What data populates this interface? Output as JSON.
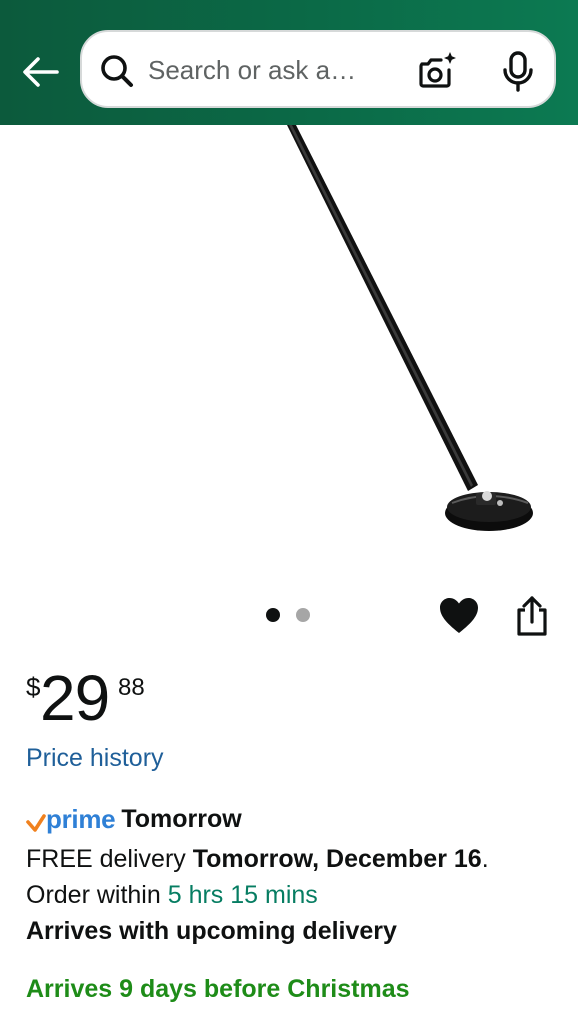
{
  "header": {
    "search_placeholder": "Search or ask a…",
    "back_icon": "arrow-left-icon",
    "search_icon": "magnifier-icon",
    "camera_icon": "camera-sparkle-icon",
    "mic_icon": "microphone-icon",
    "gradient_colors": [
      "#0c5a3c",
      "#0c7a52"
    ]
  },
  "product": {
    "image_description_icon": "kickstand-product-image",
    "carousel": {
      "count": 2,
      "active_index": 0
    },
    "favorite_icon": "heart-filled-icon",
    "share_icon": "share-icon"
  },
  "price": {
    "symbol": "$",
    "whole": "29",
    "fraction": "88"
  },
  "price_history_label": "Price history",
  "delivery": {
    "prime_label": "prime",
    "prime_speed": "Tomorrow",
    "free_delivery_prefix": "FREE delivery ",
    "delivery_date": "Tomorrow, December 16",
    "delivery_suffix": ".",
    "order_within_prefix": "Order within ",
    "order_within_time": "5 hrs 15 mins",
    "arrives_upcoming": "Arrives with upcoming delivery",
    "christmas_note": "Arrives 9 days before Christmas"
  },
  "colors": {
    "link_blue": "#1f5f99",
    "prime_blue": "#2f80d6",
    "prime_orange": "#f0811e",
    "countdown_teal": "#067d62",
    "christmas_green": "#1e8c18"
  }
}
